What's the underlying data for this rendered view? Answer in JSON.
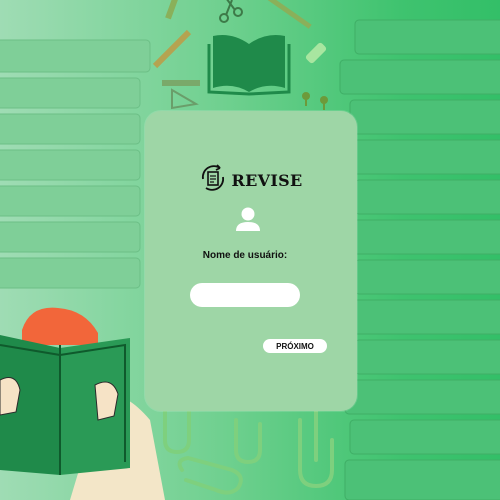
{
  "app": {
    "brand_name": "REVISE",
    "logo_icon": "notepad-refresh-icon"
  },
  "form": {
    "username_label": "Nome de usuário:",
    "username_value": "",
    "next_label": "PRÓXIMO"
  },
  "colors": {
    "card": "#9ed6a6",
    "book_green": "#1f8a4a",
    "hair": "#f2663a",
    "shirt": "#f3e6c8"
  },
  "icons": [
    "book-icon",
    "user-icon",
    "notepad-refresh-icon",
    "scissors-icon",
    "pencil-icon",
    "pushpin-icon",
    "paperclip-icon"
  ]
}
